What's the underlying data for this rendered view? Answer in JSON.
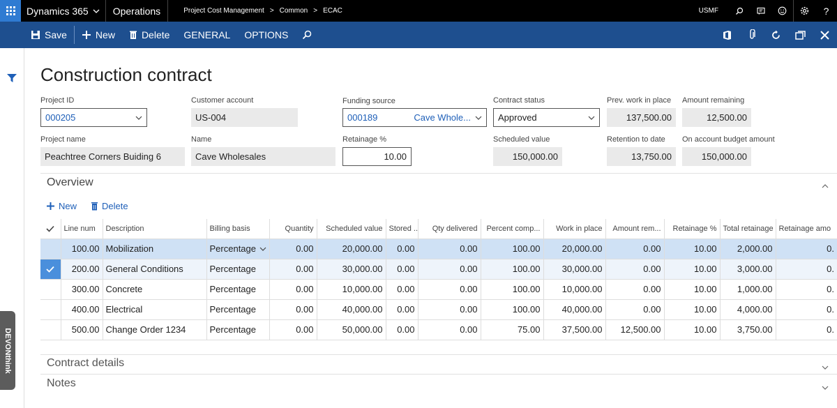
{
  "topbar": {
    "app_name": "Dynamics 365",
    "module_name": "Operations",
    "breadcrumb": [
      "Project Cost Management",
      "Common",
      "ECAC"
    ],
    "company": "USMF"
  },
  "actionbar": {
    "save_label": "Save",
    "new_label": "New",
    "delete_label": "Delete",
    "general_label": "GENERAL",
    "options_label": "OPTIONS"
  },
  "page": {
    "title": "Construction contract"
  },
  "fields": {
    "project_id": {
      "label": "Project ID",
      "value": "000205"
    },
    "customer_account": {
      "label": "Customer account",
      "value": "US-004"
    },
    "funding_source": {
      "label": "Funding source",
      "value": "000189",
      "name": "Cave Whole..."
    },
    "contract_status": {
      "label": "Contract status",
      "value": "Approved"
    },
    "prev_work_in_place": {
      "label": "Prev. work in place",
      "value": "137,500.00"
    },
    "amount_remaining": {
      "label": "Amount remaining",
      "value": "12,500.00"
    },
    "project_name": {
      "label": "Project name",
      "value": "Peachtree Corners Buiding 6"
    },
    "name": {
      "label": "Name",
      "value": "Cave Wholesales"
    },
    "retainage_pct": {
      "label": "Retainage %",
      "value": "10.00"
    },
    "scheduled_value": {
      "label": "Scheduled value",
      "value": "150,000.00"
    },
    "retention_to_date": {
      "label": "Retention to date",
      "value": "13,750.00"
    },
    "on_account_budget": {
      "label": "On account budget amount",
      "value": "150,000.00"
    }
  },
  "overview": {
    "title": "Overview",
    "new_label": "New",
    "delete_label": "Delete",
    "columns": [
      "Line num",
      "Description",
      "Billing basis",
      "Quantity",
      "Scheduled value",
      "Stored ...",
      "Qty delivered",
      "Percent comp...",
      "Work in place",
      "Amount rem...",
      "Retainage %",
      "Total retainage",
      "Retainage amo"
    ],
    "rows": [
      [
        "100.00",
        "Mobilization",
        "Percentage",
        "0.00",
        "20,000.00",
        "0.00",
        "0.00",
        "100.00",
        "20,000.00",
        "0.00",
        "10.00",
        "2,000.00",
        "0."
      ],
      [
        "200.00",
        "General Conditions",
        "Percentage",
        "0.00",
        "30,000.00",
        "0.00",
        "0.00",
        "100.00",
        "30,000.00",
        "0.00",
        "10.00",
        "3,000.00",
        "0."
      ],
      [
        "300.00",
        "Concrete",
        "Percentage",
        "0.00",
        "10,000.00",
        "0.00",
        "0.00",
        "100.00",
        "10,000.00",
        "0.00",
        "10.00",
        "1,000.00",
        "0."
      ],
      [
        "400.00",
        "Electrical",
        "Percentage",
        "0.00",
        "40,000.00",
        "0.00",
        "0.00",
        "100.00",
        "40,000.00",
        "0.00",
        "10.00",
        "4,000.00",
        "0."
      ],
      [
        "500.00",
        "Change Order 1234",
        "Percentage",
        "0.00",
        "50,000.00",
        "0.00",
        "0.00",
        "75.00",
        "37,500.00",
        "12,500.00",
        "10.00",
        "3,750.00",
        "0."
      ]
    ]
  },
  "sections": {
    "contract_details": "Contract details",
    "notes": "Notes"
  },
  "sidebar": {
    "devon_label": "DEVONthink"
  },
  "colors": {
    "topbar": "#000000",
    "actionbar": "#1e4f8f",
    "accent": "#2f7bd2",
    "link": "#1e5fb8",
    "selected_row": "#cfe1f5"
  }
}
